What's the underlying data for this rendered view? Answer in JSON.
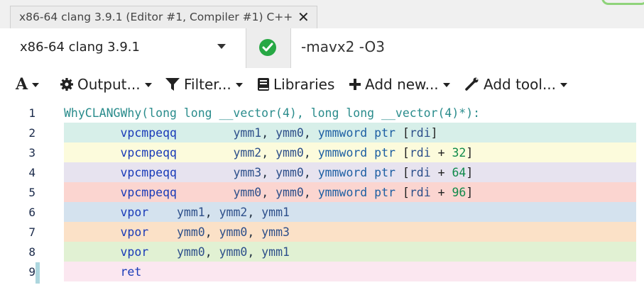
{
  "tab": {
    "title": "x86-64 clang 3.9.1 (Editor #1, Compiler #1) C++",
    "close_glyph": "✕"
  },
  "compiler": {
    "name": "x86-64 clang 3.9.1",
    "options": "-mavx2 -O3",
    "status": "compiled-ok"
  },
  "toolbar": {
    "font_label": "A",
    "output_label": "Output...",
    "filter_label": "Filter...",
    "libraries_label": "Libraries",
    "add_new_label": "Add new...",
    "add_tool_label": "Add tool..."
  },
  "colors": {
    "line2": "#d7efe9",
    "line3": "#fcfbdc",
    "line4": "#e7e3ef",
    "line5": "#fbd5d0",
    "line6": "#d4e2ee",
    "line7": "#fbe1c7",
    "line8": "#e1f1d3",
    "line9": "#fbe7f0"
  },
  "code_lines": [
    {
      "num": "1",
      "label": "WhyCLANGWhy(long long __vector(4), long long __vector(4)*):"
    },
    {
      "num": "2",
      "mnemonic": "vpcmpeqq",
      "ops": [
        "ymm1",
        "ymm0",
        "ymmword ptr [rdi]"
      ]
    },
    {
      "num": "3",
      "mnemonic": "vpcmpeqq",
      "ops": [
        "ymm2",
        "ymm0",
        "ymmword ptr [rdi + 32]"
      ]
    },
    {
      "num": "4",
      "mnemonic": "vpcmpeqq",
      "ops": [
        "ymm3",
        "ymm0",
        "ymmword ptr [rdi + 64]"
      ]
    },
    {
      "num": "5",
      "mnemonic": "vpcmpeqq",
      "ops": [
        "ymm0",
        "ymm0",
        "ymmword ptr [rdi + 96]"
      ]
    },
    {
      "num": "6",
      "mnemonic": "vpor",
      "ops": [
        "ymm1",
        "ymm2",
        "ymm1"
      ]
    },
    {
      "num": "7",
      "mnemonic": "vpor",
      "ops": [
        "ymm0",
        "ymm0",
        "ymm3"
      ]
    },
    {
      "num": "8",
      "mnemonic": "vpor",
      "ops": [
        "ymm0",
        "ymm0",
        "ymm1"
      ]
    },
    {
      "num": "9",
      "mnemonic": "ret",
      "ops": []
    }
  ]
}
